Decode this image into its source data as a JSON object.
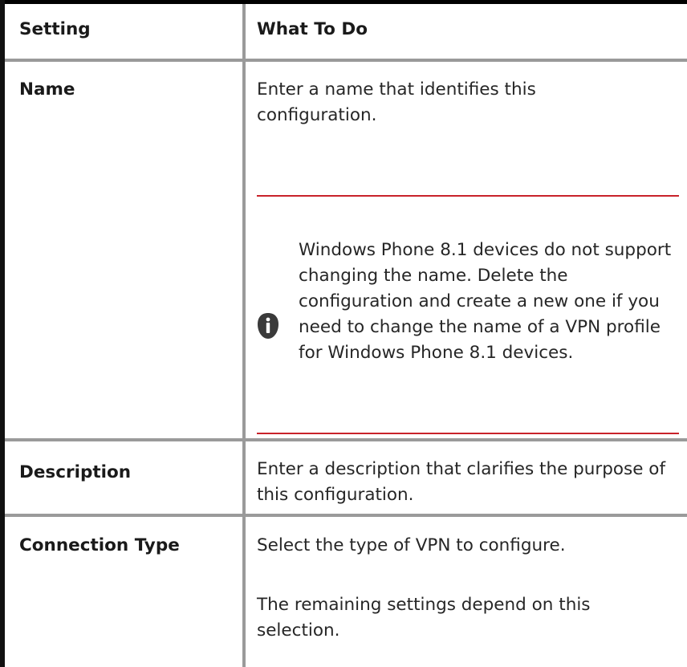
{
  "table": {
    "headers": {
      "setting": "Setting",
      "what_to_do": "What To Do"
    },
    "rows": [
      {
        "setting": "Name",
        "what_to_do": "Enter a name that identifies this configuration.",
        "note": {
          "icon": "info-icon",
          "text": "Windows Phone 8.1 devices do not support changing the name. Delete the configuration and create a new one if you need to change the name of a VPN profile for Windows Phone 8.1 devices."
        }
      },
      {
        "setting": "Description",
        "what_to_do": "Enter a description that clarifies the purpose of this configuration."
      },
      {
        "setting": "Connection Type",
        "what_to_do": "Select the type of VPN to configure.",
        "what_to_do_2": "The remaining settings depend on this selection."
      }
    ]
  },
  "colors": {
    "note_rule": "#c8222a",
    "grid": "#9a9a9a",
    "frame": "#000000",
    "icon": "#3a3a3a"
  }
}
